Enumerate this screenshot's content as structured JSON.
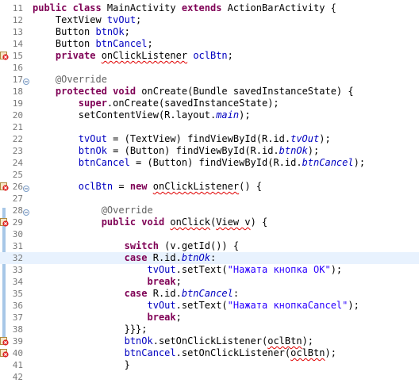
{
  "lines": [
    {
      "num": "11",
      "marker": "",
      "fold": "",
      "tokens": [
        [
          "kw",
          "public class "
        ],
        [
          "t",
          "MainActivity "
        ],
        [
          "kw",
          "extends "
        ],
        [
          "t",
          "ActionBarActivity {"
        ]
      ]
    },
    {
      "num": "12",
      "marker": "",
      "fold": "",
      "tokens": [
        [
          "t",
          "    TextView "
        ],
        [
          "fld",
          "tvOut"
        ],
        [
          "t",
          ";"
        ]
      ]
    },
    {
      "num": "13",
      "marker": "",
      "fold": "",
      "tokens": [
        [
          "t",
          "    Button "
        ],
        [
          "fld",
          "btnOk"
        ],
        [
          "t",
          ";"
        ]
      ]
    },
    {
      "num": "14",
      "marker": "",
      "fold": "",
      "tokens": [
        [
          "t",
          "    Button "
        ],
        [
          "fld",
          "btnCancel"
        ],
        [
          "t",
          ";"
        ]
      ]
    },
    {
      "num": "15",
      "marker": "error",
      "fold": "",
      "tokens": [
        [
          "kw",
          "    private "
        ],
        [
          "err",
          "onClickListener"
        ],
        [
          "t",
          " "
        ],
        [
          "fld",
          "oclBtn"
        ],
        [
          "t",
          ";"
        ]
      ]
    },
    {
      "num": "16",
      "marker": "",
      "fold": "",
      "tokens": [
        [
          "t",
          ""
        ]
      ]
    },
    {
      "num": "17",
      "marker": "",
      "fold": "collapse",
      "tokens": [
        [
          "ann",
          "    @Override"
        ]
      ]
    },
    {
      "num": "18",
      "marker": "override",
      "fold": "",
      "tokens": [
        [
          "kw",
          "    protected void "
        ],
        [
          "t",
          "onCreate(Bundle savedInstanceState) {"
        ]
      ]
    },
    {
      "num": "19",
      "marker": "",
      "fold": "",
      "tokens": [
        [
          "kw",
          "        super"
        ],
        [
          "t",
          ".onCreate(savedInstanceState);"
        ]
      ]
    },
    {
      "num": "20",
      "marker": "",
      "fold": "",
      "tokens": [
        [
          "t",
          "        setContentView(R.layout."
        ],
        [
          "fldi",
          "main"
        ],
        [
          "t",
          ");"
        ]
      ]
    },
    {
      "num": "21",
      "marker": "",
      "fold": "",
      "tokens": [
        [
          "t",
          ""
        ]
      ]
    },
    {
      "num": "22",
      "marker": "",
      "fold": "",
      "tokens": [
        [
          "t",
          "        "
        ],
        [
          "fld",
          "tvOut"
        ],
        [
          "t",
          " = (TextView) findViewById(R.id."
        ],
        [
          "fldi",
          "tvOut"
        ],
        [
          "t",
          ");"
        ]
      ]
    },
    {
      "num": "23",
      "marker": "",
      "fold": "",
      "tokens": [
        [
          "t",
          "        "
        ],
        [
          "fld",
          "btnOk"
        ],
        [
          "t",
          " = (Button) findViewById(R.id."
        ],
        [
          "fldi",
          "btnOk"
        ],
        [
          "t",
          ");"
        ]
      ]
    },
    {
      "num": "24",
      "marker": "",
      "fold": "",
      "tokens": [
        [
          "t",
          "        "
        ],
        [
          "fld",
          "btnCancel"
        ],
        [
          "t",
          " = (Button) findViewById(R.id."
        ],
        [
          "fldi",
          "btnCancel"
        ],
        [
          "t",
          ");"
        ]
      ]
    },
    {
      "num": "25",
      "marker": "",
      "fold": "",
      "tokens": [
        [
          "t",
          ""
        ]
      ]
    },
    {
      "num": "26",
      "marker": "error",
      "fold": "collapse",
      "tokens": [
        [
          "t",
          "        "
        ],
        [
          "fld",
          "oclBtn"
        ],
        [
          "t",
          " = "
        ],
        [
          "kw",
          "new "
        ],
        [
          "err",
          "onClickListener"
        ],
        [
          "t",
          "() {"
        ]
      ]
    },
    {
      "num": "27",
      "marker": "",
      "fold": "",
      "tokens": [
        [
          "t",
          ""
        ]
      ]
    },
    {
      "num": "28",
      "marker": "",
      "fold": "collapse",
      "tokens": [
        [
          "ann",
          "            @Override"
        ]
      ]
    },
    {
      "num": "29",
      "marker": "error",
      "fold": "",
      "tokens": [
        [
          "kw",
          "            public void "
        ],
        [
          "err",
          "onClick"
        ],
        [
          "t",
          "("
        ],
        [
          "err",
          "View v"
        ],
        [
          "t",
          ") {"
        ]
      ]
    },
    {
      "num": "30",
      "marker": "",
      "fold": "",
      "tokens": [
        [
          "t",
          ""
        ]
      ]
    },
    {
      "num": "31",
      "marker": "",
      "fold": "",
      "tokens": [
        [
          "kw",
          "                switch "
        ],
        [
          "t",
          "(v.getId()) {"
        ]
      ]
    },
    {
      "num": "32",
      "marker": "",
      "fold": "",
      "current": true,
      "tokens": [
        [
          "kw",
          "                case "
        ],
        [
          "t",
          "R.id."
        ],
        [
          "fldi",
          "btnOk"
        ],
        [
          "t",
          ":"
        ]
      ]
    },
    {
      "num": "33",
      "marker": "",
      "fold": "",
      "tokens": [
        [
          "t",
          "                    "
        ],
        [
          "fld",
          "tvOut"
        ],
        [
          "t",
          ".setText("
        ],
        [
          "str",
          "\"Нажата кнопка ОК\""
        ],
        [
          "t",
          ");"
        ]
      ]
    },
    {
      "num": "34",
      "marker": "",
      "fold": "",
      "tokens": [
        [
          "kw",
          "                    break"
        ],
        [
          "t",
          ";"
        ]
      ]
    },
    {
      "num": "35",
      "marker": "",
      "fold": "",
      "tokens": [
        [
          "kw",
          "                case "
        ],
        [
          "t",
          "R.id."
        ],
        [
          "fldi",
          "btnCancel"
        ],
        [
          "t",
          ":"
        ]
      ]
    },
    {
      "num": "36",
      "marker": "",
      "fold": "",
      "tokens": [
        [
          "t",
          "                    "
        ],
        [
          "fld",
          "tvOut"
        ],
        [
          "t",
          ".setText("
        ],
        [
          "str",
          "\"Нажата кнопкаCancel\""
        ],
        [
          "t",
          ");"
        ]
      ]
    },
    {
      "num": "37",
      "marker": "",
      "fold": "",
      "tokens": [
        [
          "kw",
          "                    break"
        ],
        [
          "t",
          ";"
        ]
      ]
    },
    {
      "num": "38",
      "marker": "",
      "fold": "",
      "tokens": [
        [
          "t",
          "                }}};"
        ]
      ]
    },
    {
      "num": "39",
      "marker": "error",
      "fold": "",
      "tokens": [
        [
          "t",
          "                "
        ],
        [
          "fld",
          "btnOk"
        ],
        [
          "t",
          ".setOnClickListener("
        ],
        [
          "err",
          "oclBtn"
        ],
        [
          "t",
          ");"
        ]
      ]
    },
    {
      "num": "40",
      "marker": "error",
      "fold": "",
      "tokens": [
        [
          "t",
          "                "
        ],
        [
          "fld",
          "btnCancel"
        ],
        [
          "t",
          ".setOnClickListener("
        ],
        [
          "err",
          "oclBtn"
        ],
        [
          "t",
          ");"
        ]
      ]
    },
    {
      "num": "41",
      "marker": "",
      "fold": "",
      "tokens": [
        [
          "t",
          "                }"
        ]
      ]
    },
    {
      "num": "42",
      "marker": "",
      "fold": "",
      "tokens": [
        [
          "t",
          ""
        ]
      ]
    }
  ],
  "colors": {
    "keyword": "#7f0055",
    "annotation": "#646464",
    "field": "#0000c0",
    "string": "#2a00ff",
    "line_number": "#787878",
    "current_line": "#e8f2fe",
    "error_underline": "#e00000",
    "change_bar": "#a7c7e7"
  },
  "icons": {
    "error": "error-marker-icon",
    "override": "override-marker-icon",
    "fold": "fold-collapse-icon"
  }
}
